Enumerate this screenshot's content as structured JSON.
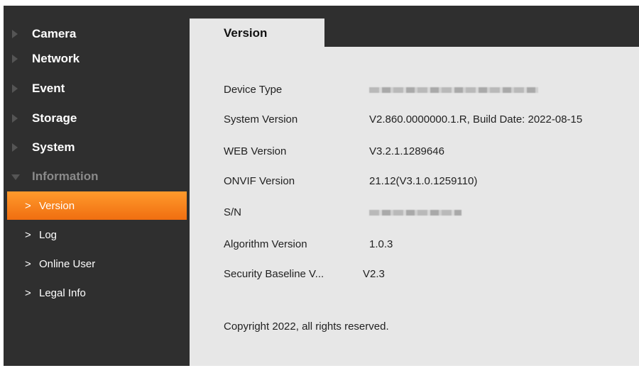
{
  "sidebar": {
    "items": [
      {
        "label": "Camera"
      },
      {
        "label": "Network"
      },
      {
        "label": "Event"
      },
      {
        "label": "Storage"
      },
      {
        "label": "System"
      },
      {
        "label": "Information"
      }
    ],
    "subitems": [
      {
        "label": "Version"
      },
      {
        "label": "Log"
      },
      {
        "label": "Online User"
      },
      {
        "label": "Legal Info"
      }
    ],
    "chevron": ">",
    "accent_color": "#f28018"
  },
  "tab": {
    "label": "Version"
  },
  "info": {
    "device_type": {
      "label": "Device Type",
      "value": ""
    },
    "system_version": {
      "label": "System Version",
      "value": "V2.860.0000000.1.R, Build Date: 2022-08-15"
    },
    "web_version": {
      "label": "WEB Version",
      "value": "V3.2.1.1289646"
    },
    "onvif_version": {
      "label": "ONVIF Version",
      "value": "21.12(V3.1.0.1259110)"
    },
    "sn": {
      "label": "S/N",
      "value": ""
    },
    "algorithm_version": {
      "label": "Algorithm Version",
      "value": "1.0.3"
    },
    "security_baseline": {
      "label": "Security Baseline V...",
      "value": "V2.3"
    }
  },
  "copyright": "Copyright 2022, all rights reserved."
}
